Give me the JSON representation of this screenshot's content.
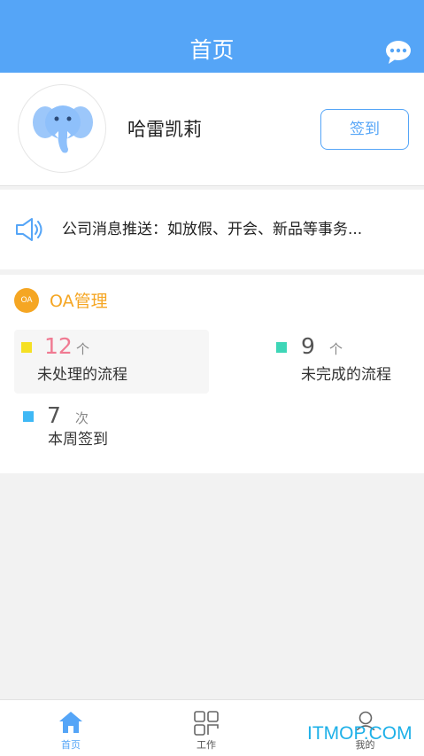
{
  "header": {
    "title": "首页"
  },
  "profile": {
    "username": "哈雷凯莉",
    "signin_label": "签到"
  },
  "notice": {
    "text": "公司消息推送：如放假、开会、新品等事务..."
  },
  "oa": {
    "badge": "OA",
    "title": "OA管理",
    "stats": [
      {
        "value": "12",
        "unit": "个",
        "label": "未处理的流程",
        "color": "#f5e024",
        "value_color": "#f07a92"
      },
      {
        "value": "9",
        "unit": "个",
        "label": "未完成的流程",
        "color": "#3ed6b7",
        "value_color": "#555555"
      },
      {
        "value": "7",
        "unit": "次",
        "label": "本周签到",
        "color": "#3fb8f5",
        "value_color": "#555555"
      }
    ]
  },
  "tabbar": {
    "items": [
      {
        "label": "首页",
        "icon": "home-icon",
        "active": true
      },
      {
        "label": "工作",
        "icon": "grid-icon",
        "active": false
      },
      {
        "label": "我的",
        "icon": "user-icon",
        "active": false
      }
    ]
  },
  "watermark": "ITMOP.COM",
  "colors": {
    "primary": "#55a5f7",
    "accent": "#f5a623"
  }
}
